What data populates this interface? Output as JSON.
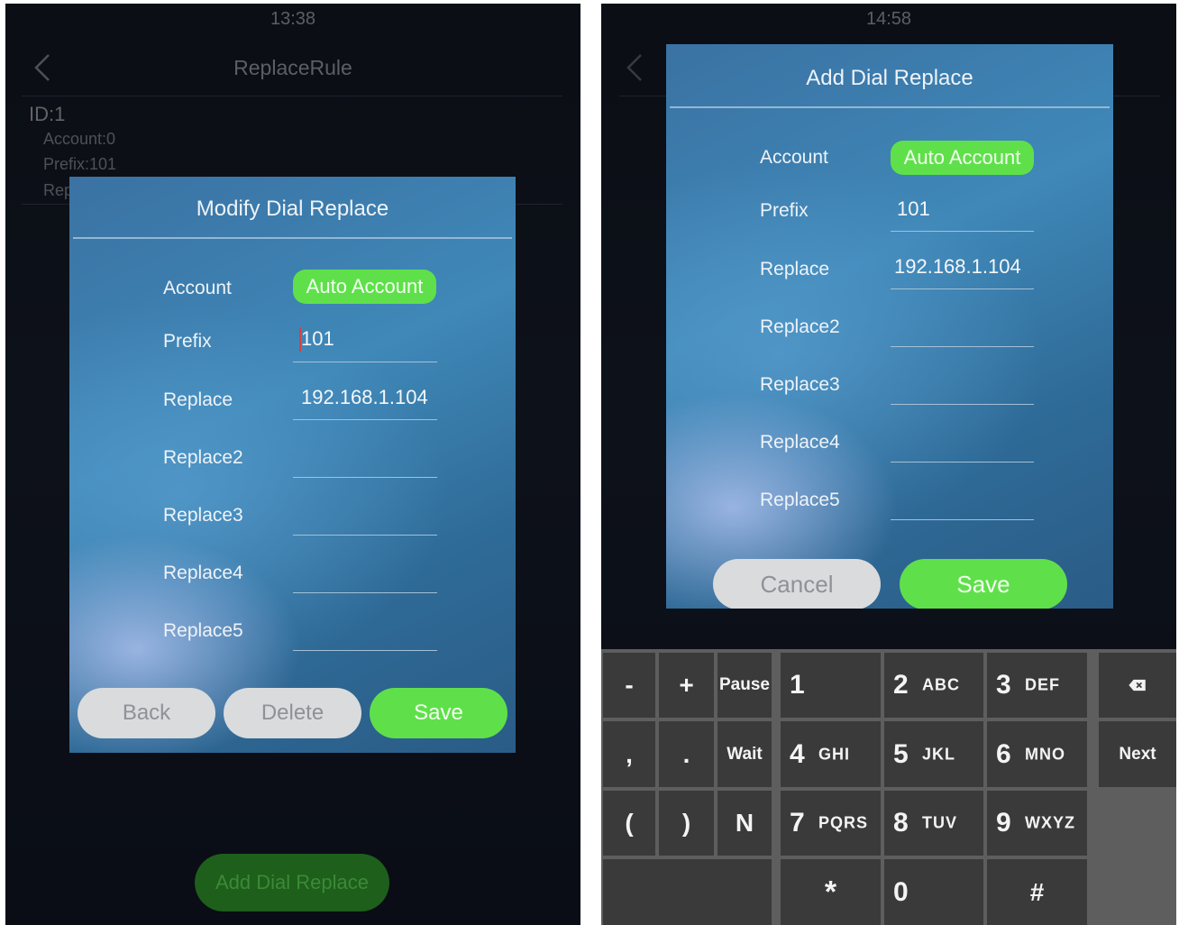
{
  "left": {
    "status_time": "13:38",
    "header_title": "ReplaceRule",
    "rule": {
      "id": "ID:1",
      "account": "Account:0",
      "prefix": "Prefix:101",
      "replace_partial": "Rep"
    },
    "add_button": "Add Dial Replace",
    "dialog": {
      "title": "Modify Dial Replace",
      "account_label": "Account",
      "account_value": "Auto Account",
      "prefix_label": "Prefix",
      "prefix_value": "101",
      "replace_label": "Replace",
      "replace_value": "192.168.1.104",
      "replace2_label": "Replace2",
      "replace3_label": "Replace3",
      "replace4_label": "Replace4",
      "replace5_label": "Replace5",
      "back_label": "Back",
      "delete_label": "Delete",
      "save_label": "Save"
    }
  },
  "right": {
    "status_time": "14:58",
    "dialog": {
      "title": "Add Dial Replace",
      "account_label": "Account",
      "account_value": "Auto Account",
      "prefix_label": "Prefix",
      "prefix_value": "101",
      "replace_label": "Replace",
      "replace_value": "192.168.1.104",
      "replace2_label": "Replace2",
      "replace3_label": "Replace3",
      "replace4_label": "Replace4",
      "replace5_label": "Replace5",
      "cancel_label": "Cancel",
      "save_label": "Save"
    },
    "keyboard": {
      "minus": "-",
      "plus": "+",
      "pause": "Pause",
      "one": "1",
      "two": "2",
      "two_letters": "ABC",
      "three": "3",
      "three_letters": "DEF",
      "comma": ",",
      "period": ".",
      "wait": "Wait",
      "four": "4",
      "four_letters": "GHI",
      "five": "5",
      "five_letters": "JKL",
      "six": "6",
      "six_letters": "MNO",
      "next": "Next",
      "open_paren": "(",
      "close_paren": ")",
      "n": "N",
      "seven": "7",
      "seven_letters": "PQRS",
      "eight": "8",
      "eight_letters": "TUV",
      "nine": "9",
      "nine_letters": "WXYZ",
      "star": "*",
      "zero": "0",
      "hash": "#"
    }
  },
  "colors": {
    "accent_green": "#5fe04a",
    "dialog_blue": "#3f88b8"
  },
  "icons": [
    "chevron-left-icon",
    "backspace-icon"
  ]
}
